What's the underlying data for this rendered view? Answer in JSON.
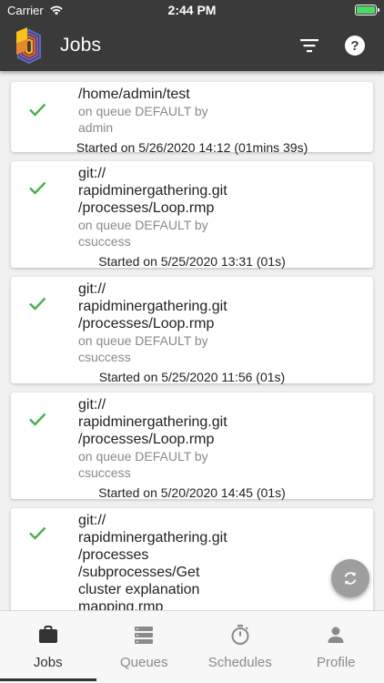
{
  "status_bar": {
    "carrier": "Carrier",
    "time": "2:44 PM"
  },
  "header": {
    "title": "Jobs",
    "filter_icon": "filter-icon",
    "help_icon": "help-icon"
  },
  "colors": {
    "header_bg": "#3a3a3a",
    "check_green": "#4caf50",
    "fab_bg": "#9e9e9e",
    "active_tab": "#333333",
    "inactive_tab": "#8a8a8a"
  },
  "jobs": [
    {
      "path_lines": [
        "/home/admin/test"
      ],
      "queue_lines": [
        "on queue DEFAULT by",
        "admin"
      ],
      "started": "Started on 5/26/2020 14:12    (01mins 39s)"
    },
    {
      "path_lines": [
        "git://",
        "rapidminergathering.git",
        "/processes/Loop.rmp"
      ],
      "queue_lines": [
        "on queue DEFAULT by",
        "csuccess"
      ],
      "started": "Started on 5/25/2020 13:31    (01s)"
    },
    {
      "path_lines": [
        "git://",
        "rapidminergathering.git",
        "/processes/Loop.rmp"
      ],
      "queue_lines": [
        "on queue DEFAULT by",
        "csuccess"
      ],
      "started": "Started on 5/25/2020 11:56    (01s)"
    },
    {
      "path_lines": [
        "git://",
        "rapidminergathering.git",
        "/processes/Loop.rmp"
      ],
      "queue_lines": [
        "on queue DEFAULT by",
        "csuccess"
      ],
      "started": "Started on 5/20/2020 14:45    (01s)"
    },
    {
      "path_lines": [
        "git://",
        "rapidminergathering.git",
        "/processes",
        "/subprocesses/Get",
        "cluster explanation",
        "mapping.rmp"
      ],
      "queue_lines": [],
      "started": ""
    }
  ],
  "tabs": [
    {
      "label": "Jobs",
      "icon": "briefcase-icon",
      "active": true
    },
    {
      "label": "Queues",
      "icon": "queues-icon",
      "active": false
    },
    {
      "label": "Schedules",
      "icon": "stopwatch-icon",
      "active": false
    },
    {
      "label": "Profile",
      "icon": "person-icon",
      "active": false
    }
  ]
}
